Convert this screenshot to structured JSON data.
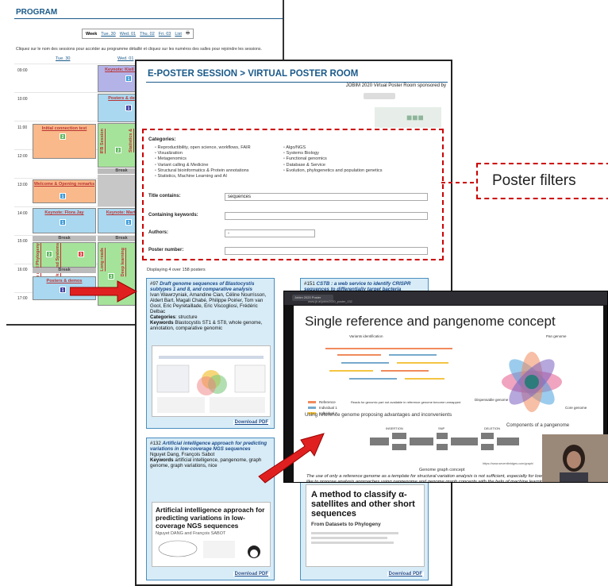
{
  "program": {
    "title": "PROGRAM",
    "view_options": [
      "Week",
      "Tue. 30",
      "Wed. 01",
      "Thu. 02",
      "Fri. 03",
      "List"
    ],
    "instruction": "Cliquez sur le nom des sessions pour accéder au programme détaillé et cliquez sur les numéros des salles pour rejoindre les sessions.",
    "days": [
      "Tue. 30",
      "Wed. 01"
    ],
    "times": [
      "09:00",
      "10:00",
      "11:00",
      "12:00",
      "13:00",
      "14:00",
      "15:00",
      "16:00",
      "17:00"
    ],
    "sessions": {
      "keynote_kiell": "Keynote: Kiell P",
      "posters_de": "Posters & de",
      "initial_connection": "Initial connection test",
      "ifb_session": "IFB Session",
      "statistics": "Statistics &",
      "break": "Break",
      "welcome_opening": "Welcome & Opening remarks",
      "keynote_flora": "Keynote: Flora Jay",
      "keynote_marti": "Keynote: Marti",
      "break_2": "Break",
      "evolution": "Evolution and Phylogeny",
      "networks": "Networks and Systems",
      "long_reads": "Long reads",
      "deep_learning": "Deep learning",
      "break_3": "Break",
      "posters_demos": "Posters & demos",
      "break_wed": "Break",
      "break_wed_2": "Break"
    },
    "room_numbers": {
      "a": "1",
      "b": "2",
      "c": "2",
      "d": "3",
      "e": "1",
      "f": "1",
      "g": "1",
      "h": "1",
      "i": "2",
      "j": "1",
      "k": "3"
    }
  },
  "eposter": {
    "title": "E-POSTER SESSION > VIRTUAL POSTER ROOM",
    "sponsor_text": "JOBIM 2020 Virtual Poster Room sponsored by",
    "categories_label": "Categories:",
    "categories_left": [
      "Reproductibility, open science, workflows, FAIR",
      "Visualization",
      "Metagenomics",
      "Variant calling & Medicine",
      "Structural bioinformatics & Protein annotations",
      "Statistics, Machine Learning and AI"
    ],
    "categories_right": [
      "Algo/NGS",
      "Systems Biology",
      "Functional genomics",
      "Database & Service",
      "Evolution, phylogenetics and population genetics"
    ],
    "title_label": "Title contains:",
    "title_value": "sequences",
    "keywords_label": "Containing keywords:",
    "authors_label": "Authors:",
    "authors_value": "-",
    "poster_number_label": "Poster number:",
    "displaying": "Displaying 4 over 158 posters",
    "download": "Download PDF",
    "posters": [
      {
        "number": "#97",
        "title": "Draft genome sequences of Blastocystis subtypes 1 and 8, and comparative analysis",
        "authors": "Ivan Wawrzyniak, Amandine Cian, Céline Nourrisson, Aldert Bart, Magali Chabé, Philippe Poirier, Tom van Gool, Eric Peyretaillade, Eric Viscogliosi, Frédéric Delbac",
        "categories_label": "Categories",
        "categories": "structure",
        "keywords_label": "Keywords",
        "keywords": "Blastocystis ST1 & ST8, whole genome, annotation, comparative genomic"
      },
      {
        "number": "#151",
        "title": "CSTB : a web service to identify CRISPR sequences to differentially target bacteria"
      },
      {
        "number": "#132",
        "title": "Artificial intelligence approach for predicting variations in low-coverage NGS sequences",
        "authors": "Nguyet Dang, François Sabot",
        "keywords_label": "Keywords",
        "keywords": "artificial intelligence, pangenome, graph genome, graph variations, nice",
        "thumb_title": "Artificial intelligence approach for predicting variations in low-coverage NGS sequences",
        "thumb_authors": "Nguyet DANG and François SABOT"
      },
      {
        "thumb_title": "A method to classify α-satellites and other short sequences",
        "thumb_sub": "From Datasets to Phylogeny"
      }
    ]
  },
  "video": {
    "tab_title": "Jobim 2020 Poster",
    "address": "www.jb.ai/jobim2020_poster_132",
    "slide_title": "Single reference and pangenome concept",
    "slide_subtitle": "Using reference genome proposing advantages and inconvenients",
    "labels": {
      "variants": "Variants identification",
      "reference": "Reference",
      "individual1": "Individual 1",
      "individual2": "Individual 2",
      "reads_note": "Reads for genomic part not available in reference genome become unmapped",
      "pan_genome": "Pan genome",
      "dispensable": "Dispensable genome",
      "core": "Core genome",
      "components": "Components of a pangenome",
      "graph_concept": "Genome graph concept",
      "insertion": "INSERTION",
      "snp": "SNP",
      "deletion": "DELETION",
      "url": "https://www.seventbridges.com/graph/"
    },
    "caption": "The use of only a reference genome as a template for structural variation analysis is not sufficient, especially for low-coverage sequencing data. Hence, we would like to propose analysis approaches using pangenome and genome graph concepts with the help of machine learning algorithms for structural variation analysis."
  },
  "callout": {
    "label": "Poster filters"
  },
  "colors": {
    "accent": "#1a5a8a",
    "dashed": "#cc0000",
    "arrow": "#e02020"
  }
}
